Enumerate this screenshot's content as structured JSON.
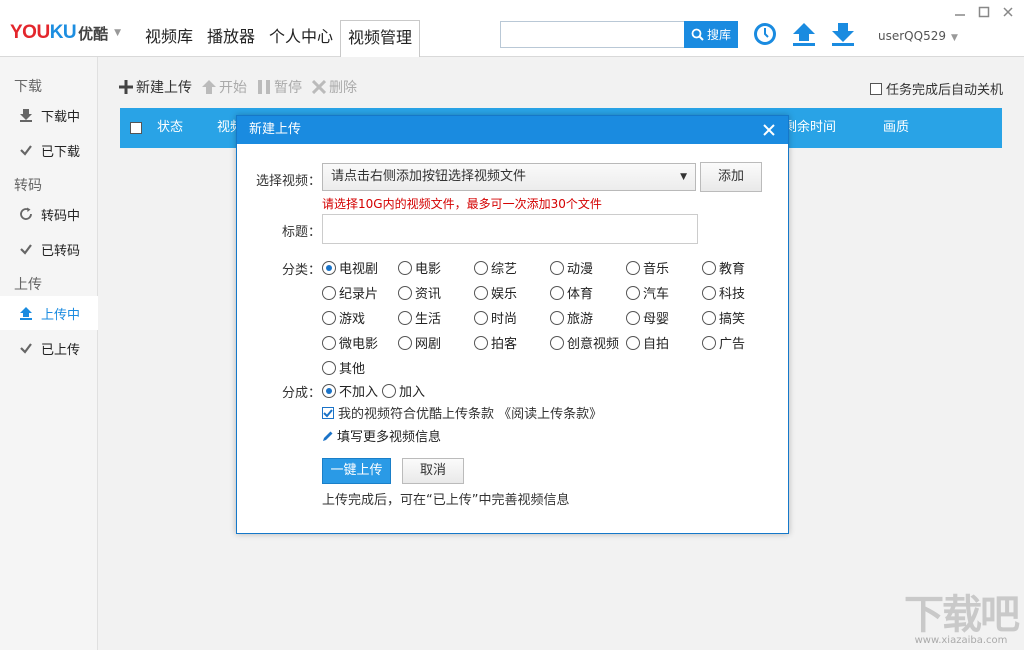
{
  "app": {
    "logo_text": "YOUKU",
    "logo_cn": "优酷"
  },
  "nav": {
    "tabs": [
      {
        "label": "视频库"
      },
      {
        "label": "播放器"
      },
      {
        "label": "个人中心"
      },
      {
        "label": "视频管理"
      }
    ]
  },
  "search": {
    "placeholder": "",
    "button_label": "搜库"
  },
  "user": {
    "name": "userQQ529"
  },
  "sidebar": {
    "sections": [
      {
        "title": "下载",
        "items": [
          {
            "label": "下载中"
          },
          {
            "label": "已下载"
          }
        ]
      },
      {
        "title": "转码",
        "items": [
          {
            "label": "转码中"
          },
          {
            "label": "已转码"
          }
        ]
      },
      {
        "title": "上传",
        "items": [
          {
            "label": "上传中"
          },
          {
            "label": "已上传"
          }
        ]
      }
    ]
  },
  "toolbar": {
    "new_upload": "新建上传",
    "start": "开始",
    "pause": "暂停",
    "delete": "删除",
    "auto_shutdown": "任务完成后自动关机"
  },
  "table": {
    "headers": {
      "status": "状态",
      "video": "视频",
      "remaining": "剩余时间",
      "quality": "画质"
    }
  },
  "dialog": {
    "title": "新建上传",
    "select_label": "选择视频：",
    "select_value": "请点击右侧添加按钮选择视频文件",
    "add_button": "添加",
    "warning": "请选择10G内的视频文件，最多可一次添加30个文件",
    "title_label": "标题：",
    "title_value": "",
    "category_label": "分类：",
    "categories": [
      "电视剧",
      "电影",
      "综艺",
      "动漫",
      "音乐",
      "教育",
      "纪录片",
      "资讯",
      "娱乐",
      "体育",
      "汽车",
      "科技",
      "游戏",
      "生活",
      "时尚",
      "旅游",
      "母婴",
      "搞笑",
      "微电影",
      "网剧",
      "拍客",
      "创意视频",
      "自拍",
      "广告",
      "其他"
    ],
    "selected_category": "电视剧",
    "share_label": "分成：",
    "share_options": [
      "不加入",
      "加入"
    ],
    "selected_share": "不加入",
    "agreement": "我的视频符合优酷上传条款 《阅读上传条款》",
    "agreement_checked": true,
    "more_info": "填写更多视频信息",
    "upload_button": "一键上传",
    "cancel_button": "取消",
    "tip": "上传完成后，可在“已上传”中完善视频信息"
  },
  "watermark": {
    "big": "下载吧",
    "small": "www.xiazaiba.com"
  },
  "colors": {
    "accent": "#1a8be0",
    "table_header": "#29a3e6",
    "warning": "#d40000"
  }
}
